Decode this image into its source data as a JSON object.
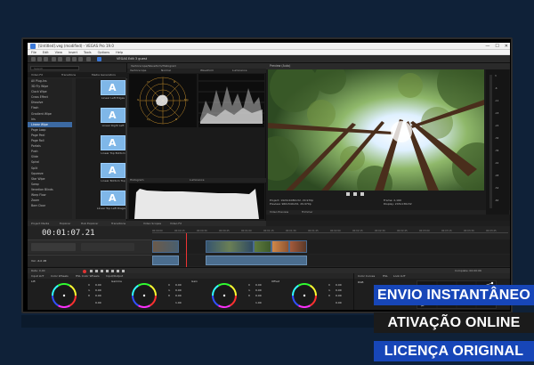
{
  "app": {
    "title": "[Untitled].veg (modified) - VEGAS Pro 19.0",
    "window_controls": [
      "—",
      "☐",
      "✕"
    ],
    "menu": [
      "File",
      "Edit",
      "View",
      "Insert",
      "Tools",
      "Options",
      "Help"
    ],
    "trial_label": "VEGAS Edit 3 guest"
  },
  "explorer": {
    "search_placeholder": "Search",
    "tabs": [
      "Video FX",
      "Transitions",
      "Media Generators"
    ],
    "selected_tab_label": "All Plug-Ins",
    "fx_items": [
      "All Plug-Ins",
      "3D Fly Wipe",
      "Clock Wipe",
      "Cross Effect",
      "Dissolve",
      "Flash",
      "Gradient Wipe",
      "Iris",
      "Linear Wipe",
      "Page Loop",
      "Page Peel",
      "Page Roll",
      "Portals",
      "Push",
      "Slide",
      "Spiral",
      "Split",
      "Squeeze",
      "Star Wipe",
      "Swap",
      "Venetian Blinds",
      "Warp Flow",
      "Zoom",
      "Barn Door"
    ],
    "selected_index": 8,
    "thumbnails": [
      {
        "caption": "Linear Left Edges",
        "glyph": "A"
      },
      {
        "caption": "Linear Right Left",
        "glyph": "A"
      },
      {
        "caption": "Linear Top Bottom",
        "glyph": "A"
      },
      {
        "caption": "Linear Bottom Top",
        "glyph": "A"
      },
      {
        "caption": "Linear Top Left Diagonal",
        "glyph": "A"
      }
    ]
  },
  "scopes": {
    "header": "Vectorscope/Waveform/Histogram",
    "labels": [
      "Vectorscope",
      "Normal",
      "Waveform",
      "Luminance"
    ],
    "hist_labels": [
      "Histogram",
      "Luminance"
    ],
    "vectorscope_marks": [
      "R",
      "Mg",
      "B",
      "Cy",
      "G",
      "Yl"
    ]
  },
  "preview": {
    "header": "Preview (Auto)",
    "info_left": [
      "Project: 1920x1080x32, 29.970p",
      "Preview: 960x540x32, 29.970p"
    ],
    "info_right": [
      "Frame: 2,160",
      "Display: 243x136x32"
    ],
    "tabs": [
      "Video Preview",
      "Trimmer"
    ],
    "meter_ticks": [
      "3",
      "-6",
      "-12",
      "-18",
      "-24",
      "-30",
      "-36",
      "-42",
      "-48",
      "-54",
      "-60"
    ]
  },
  "upper_tabs": [
    "Project Media",
    "Explorer",
    "Hub Explorer",
    "Transitions",
    "Video Scopes",
    "Video FX"
  ],
  "status_line": "VEGAS Gradient Wipe, OFX, 32 bit floating point",
  "timeline": {
    "timecode": "00:01:07.21",
    "ruler": [
      "00:00:00",
      "00:00:15",
      "00:00:30",
      "00:00:45",
      "00:01:00",
      "00:01:15",
      "00:01:30",
      "00:01:45",
      "00:02:00",
      "00:02:15",
      "00:02:30",
      "00:02:45",
      "00:03:00",
      "00:03:15",
      "00:03:30",
      "00:03:45"
    ],
    "audio_track_label": "Vol: -6.0 dB",
    "rate_label": "Rate: 0,00",
    "complete_label": "Complete: 00:00:06"
  },
  "grading": {
    "tabs": [
      "Input LUT",
      "Color Wheels",
      "HSL Color Wheels",
      "Input/Output"
    ],
    "wheels": [
      {
        "title": "Lift",
        "channels": [
          "R",
          "G",
          "B"
        ],
        "values": [
          "0.00",
          "0.00",
          "0.00"
        ],
        "alpha": "0.00"
      },
      {
        "title": "Gamma",
        "channels": [
          "R",
          "G",
          "B"
        ],
        "values": [
          "0.00",
          "0.00",
          "0.00"
        ],
        "alpha": "1.00"
      },
      {
        "title": "Gain",
        "channels": [
          "R",
          "G",
          "B"
        ],
        "values": [
          "0.00",
          "0.00",
          "0.00"
        ],
        "alpha": "1.00"
      },
      {
        "title": "Offset",
        "channels": [
          "R",
          "G",
          "B"
        ],
        "values": [
          "0.00",
          "0.00",
          "0.00"
        ],
        "alpha": "0.00"
      }
    ]
  },
  "curves": {
    "tabs": [
      "Color Curves",
      "HSL",
      "Look LUT"
    ],
    "channel": "RGB"
  },
  "badges": [
    "ENVIO INSTANTÂNEO",
    "ATIVAÇÃO ONLINE",
    "LICENÇA ORIGINAL"
  ],
  "colors": {
    "background": "#0f2138",
    "badge_blue": "#1746b8",
    "badge_dark": "#1b1b1b",
    "selection": "#3c6aa3"
  }
}
